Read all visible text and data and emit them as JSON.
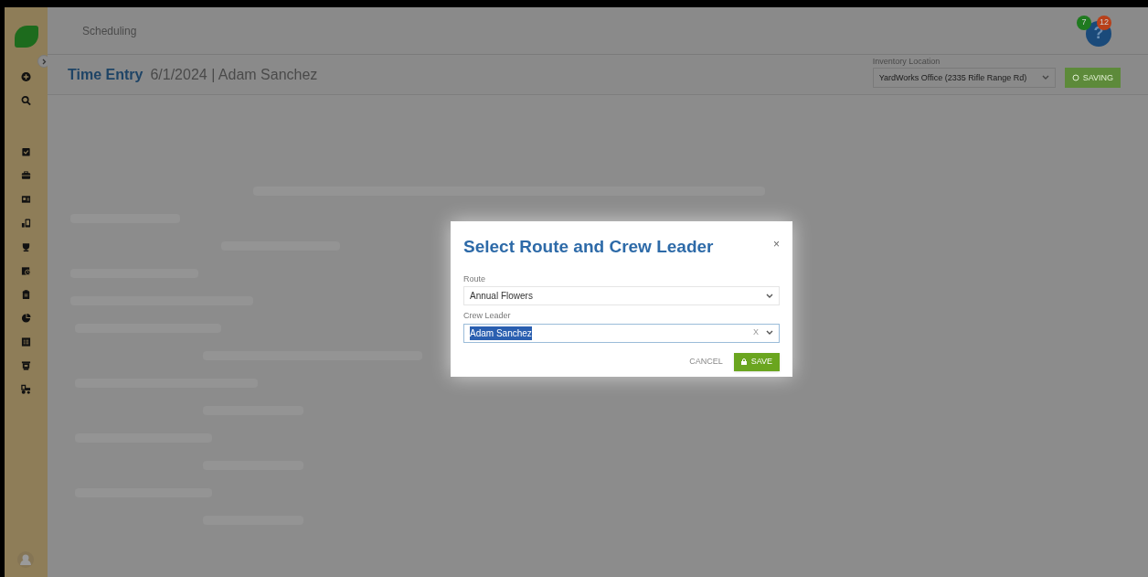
{
  "sidebar": {
    "items": [
      {
        "kind": "plus"
      },
      {
        "kind": "search"
      },
      {
        "kind": "check"
      },
      {
        "kind": "briefcase"
      },
      {
        "kind": "card"
      },
      {
        "kind": "devices"
      },
      {
        "kind": "trophy"
      },
      {
        "kind": "calendar"
      },
      {
        "kind": "clipboard"
      },
      {
        "kind": "pie"
      },
      {
        "kind": "list"
      },
      {
        "kind": "printer"
      },
      {
        "kind": "tractor"
      }
    ]
  },
  "header": {
    "breadcrumb": "Scheduling",
    "help": {
      "glyph": "?",
      "badges": [
        {
          "count": "7",
          "color": "#1f7a1f"
        },
        {
          "count": "12",
          "color": "#b8401a"
        }
      ]
    }
  },
  "page": {
    "title": "Time Entry",
    "subtitle": "6/1/2024 | Adam Sanchez",
    "inventory": {
      "label": "Inventory Location",
      "value": "YardWorks Office (2335 Rifle Range Rd)"
    },
    "saving_button": "SAVING"
  },
  "dialog": {
    "title": "Select Route and Crew Leader",
    "close": "×",
    "fields": [
      {
        "label": "Route",
        "value": "Annual Flowers",
        "text_selected": false
      },
      {
        "label": "Crew Leader",
        "value": "Adam Sanchez",
        "clear": "X",
        "text_selected": true
      }
    ],
    "buttons": [
      {
        "label": "CANCEL",
        "kind": "flat"
      },
      {
        "label": "SAVE",
        "kind": "primary"
      }
    ]
  }
}
